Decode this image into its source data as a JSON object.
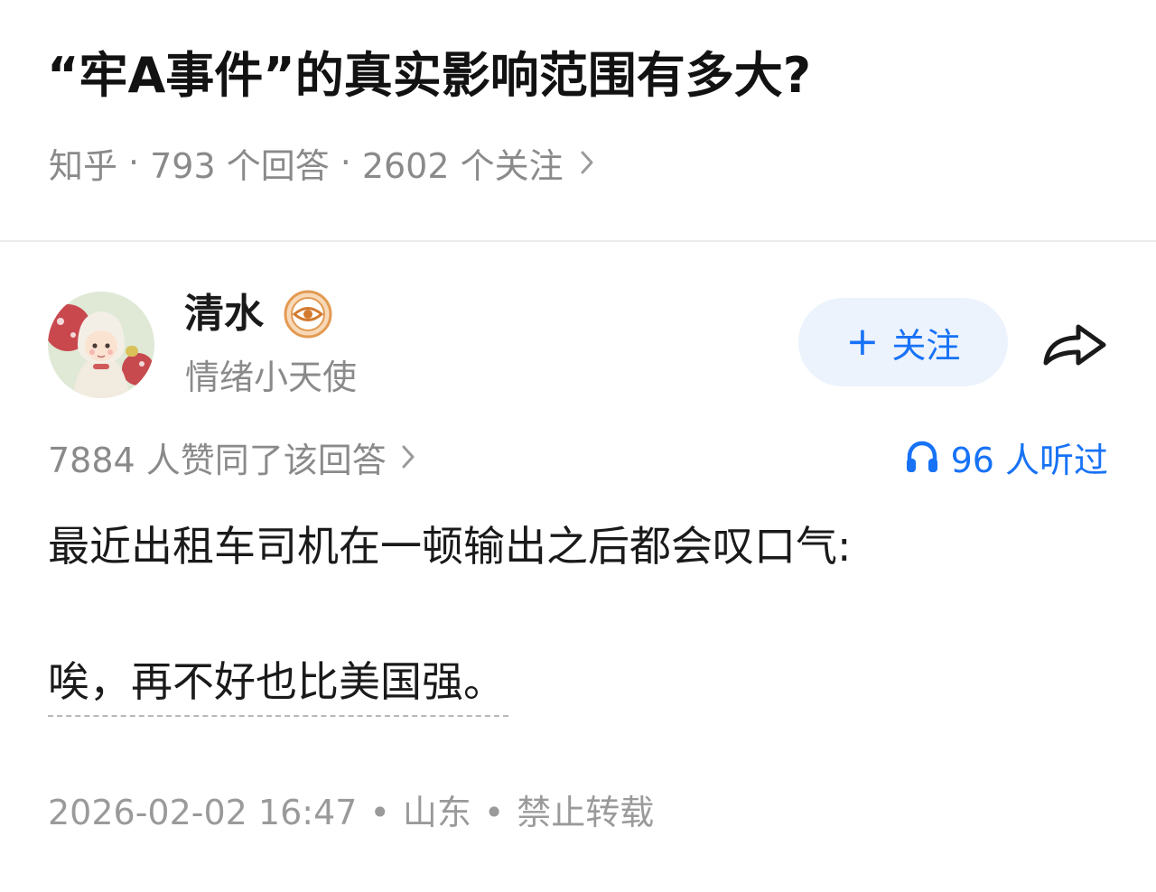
{
  "question": {
    "title": "“牢A事件”的真实影响范围有多大?",
    "source": "知乎",
    "answers_count": "793 个回答",
    "followers_count": "2602 个关注"
  },
  "author": {
    "name": "清水",
    "badge_icon": "eye-badge-icon",
    "bio": "情绪小天使",
    "avatar_icon": "avatar-girl-hood-icon"
  },
  "actions": {
    "follow_plus": "+",
    "follow_label": "关注",
    "share_icon": "share-arrow-icon"
  },
  "stats": {
    "votes_text": "7884 人赞同了该回答",
    "listens_text": "96 人听过",
    "listen_icon": "headphones-icon",
    "accent_color": "#1772f6"
  },
  "answer": {
    "paragraph1": "最近出租车司机在一顿输出之后都会叹口气:",
    "paragraph2": "唉，再不好也比美国强。"
  },
  "footer": {
    "datetime": "2026-02-02 16:47",
    "location": "山东",
    "copyright": "禁止转载"
  }
}
